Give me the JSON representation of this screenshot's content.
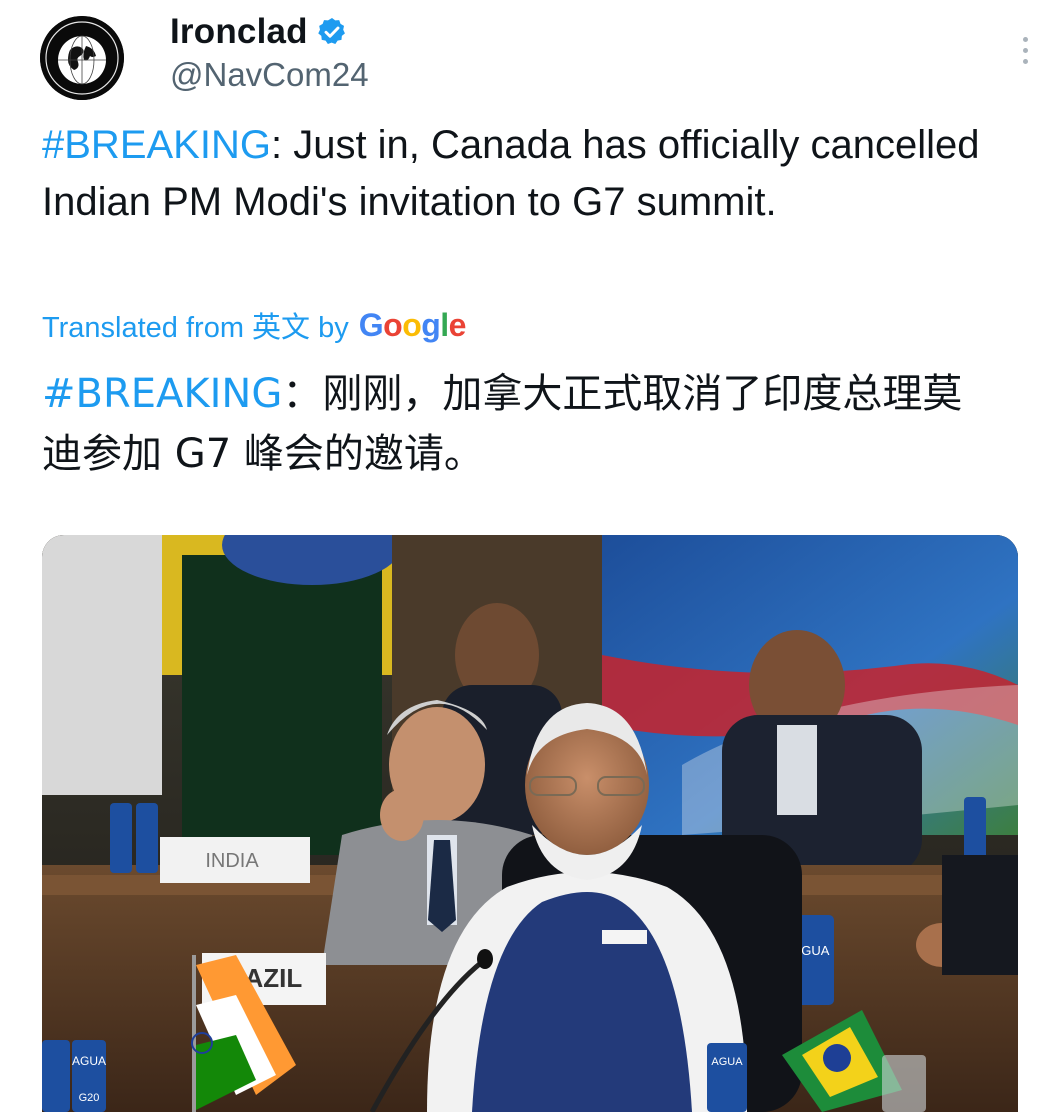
{
  "author": {
    "display_name": "Ironclad",
    "handle": "@NavCom24",
    "verified": true,
    "avatar_icon": "globe-seal-icon"
  },
  "tweet": {
    "hashtag": "#BREAKING",
    "text": ": Just in, Canada has officially cancelled Indian PM Modi's invitation to G7 summit."
  },
  "translation": {
    "label": "Translated from 英文 by",
    "provider": "Google",
    "hashtag": "#BREAKING",
    "text": "：刚刚，加拿大正式取消了印度总理莫迪参加 G7 峰会的邀请。"
  },
  "media": {
    "placards": [
      "INDIA",
      "RAZIL"
    ],
    "cans": [
      "AGUA",
      "AGUA",
      "AGUA"
    ],
    "logo": "G20"
  },
  "colors": {
    "accent": "#1d9bf0",
    "handle": "#536471",
    "text": "#0f1419"
  }
}
